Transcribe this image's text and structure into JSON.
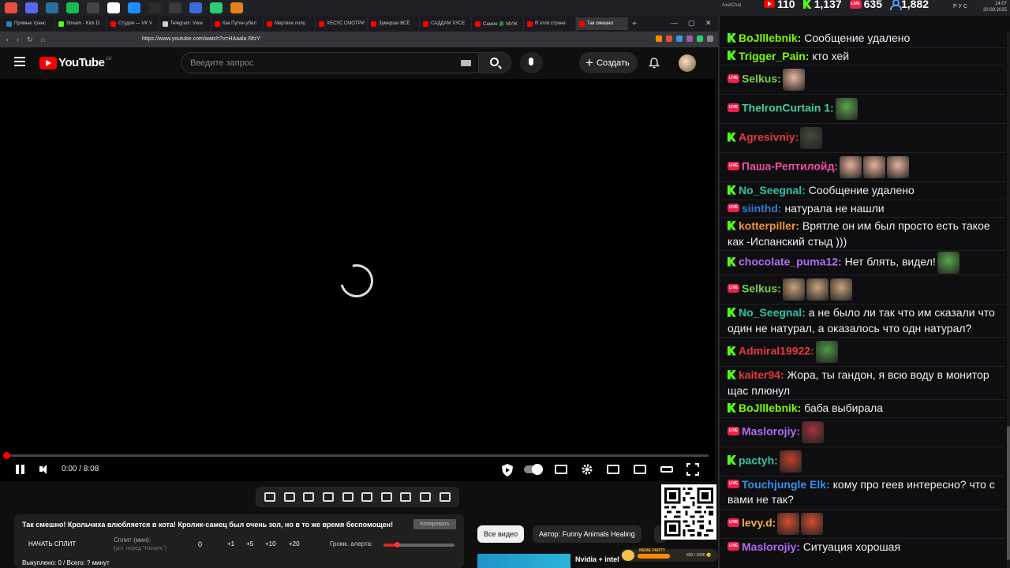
{
  "taskbar": {
    "clock_time": "14:07",
    "clock_date": "20.09.2025",
    "lang": "РУС",
    "icon_colors": [
      "#e74c3c",
      "#5865f2",
      "#2a6e9f",
      "#1db954",
      "#444",
      "#ffffff",
      "#1f8cff",
      "#2c2c2c",
      "#3a3a3a",
      "#3a6cd6",
      "#2ecc71",
      "#e67e22"
    ]
  },
  "browser": {
    "tabs": [
      {
        "label": "Прямые транс",
        "color": "#2980b9"
      },
      {
        "label": "Stream - Kick D",
        "color": "#53fc18"
      },
      {
        "label": "Студия — VK V",
        "color": "#ff0000"
      },
      {
        "label": "Telegram: View",
        "color": "#cccccc"
      },
      {
        "label": "Как Путин убил",
        "color": "#ff0000"
      },
      {
        "label": "Мертвое полу",
        "color": "#ff0000"
      },
      {
        "label": "ХЕСУС СМОТРИ",
        "color": "#ff0000"
      },
      {
        "label": "Зумерши ВСЁ",
        "color": "#ff0000"
      },
      {
        "label": "САДДАМ ХУСЕ",
        "color": "#ff0000"
      },
      {
        "label": "Самое 🐉 МУЖ",
        "color": "#ff0000"
      },
      {
        "label": "В этой стране",
        "color": "#ff0000"
      },
      {
        "label": "Так смешно",
        "color": "#ff0000",
        "active": true
      }
    ],
    "url": "https://www.youtube.com/watch?v=HAaala l9fzY"
  },
  "youtube": {
    "logo_text": "YouTube",
    "country": "LV",
    "search_placeholder": "Введите запрос",
    "create_label": "Создать",
    "time": "0:00 / 8:08",
    "progress": 0
  },
  "split": {
    "title": "Так смешно! Крольчиха влюбляется в кота! Кролик-самец был очень зол, но в то же время беспомощен!",
    "copy_label": "Копировать",
    "start_label": "НАЧАТЬ СПЛИТ",
    "minutes_label": "Сплит (мин):",
    "minutes_hint": "(уст. перед \"Начать\")",
    "minutes_value": "0",
    "adds": [
      "+1",
      "+5",
      "+10",
      "+20"
    ],
    "alert_volume_label": "Громк. алерта:",
    "alert_volume": 0.2,
    "bought_label": "Выкуплено: 0 / Всего: ? минут"
  },
  "chips": {
    "all": "Все видео",
    "author": "Автор: Funny Animals Healing"
  },
  "suggestion": {
    "title": "Nvidia + intel"
  },
  "meme": {
    "label": "MEME PARTY",
    "count": "650 / 1500 😊",
    "fill": 0.43
  },
  "chat": {
    "app_name": "AxelChat",
    "stats": {
      "youtube": "110",
      "kick": "1,137",
      "live": "635",
      "viewers": "1,882"
    },
    "messages": [
      {
        "src": "kick",
        "name": "BoJlllebnik:",
        "color": "#7cfc00",
        "text": "Сообщение удалено"
      },
      {
        "src": "kick",
        "name": "Trigger_Pain:",
        "color": "#7cfc00",
        "text": "кто хей"
      },
      {
        "src": "live",
        "name": "Selkus:",
        "color": "#7ccd4a",
        "text": "",
        "emotes": [
          "#e9b9a3"
        ]
      },
      {
        "src": "live",
        "name": "TheIronCurtain 1:",
        "color": "#3fcf9e",
        "text": "",
        "emotes": [
          "#5aa64c"
        ]
      },
      {
        "src": "kick",
        "name": "Agresivniy:",
        "color": "#e33b3b",
        "text": "",
        "emotes": [
          "#3e4a3a"
        ]
      },
      {
        "src": "live",
        "name": "Паша-Рептилойд:",
        "color": "#f04f9d",
        "text": "",
        "emotes": [
          "#e6b29b",
          "#e6b29b",
          "#e6b29b"
        ]
      },
      {
        "src": "kick",
        "name": "No_Seegnal:",
        "color": "#2ec3a4",
        "text": "Сообщение удалено"
      },
      {
        "src": "live",
        "name": "siinthd:",
        "color": "#2f7bd1",
        "text": "натурала не нашли"
      },
      {
        "src": "kick",
        "name": "kotterpiller:",
        "color": "#f29437",
        "text": "Врятле он им был просто есть такое как -Испанский стыд )))"
      },
      {
        "src": "kick",
        "name": "chocolate_puma12:",
        "color": "#b06bf5",
        "text": "Нет блять, видел!",
        "emotes": [
          "#58a94d"
        ]
      },
      {
        "src": "live",
        "name": "Selkus:",
        "color": "#7ccd4a",
        "text": "",
        "emotes": [
          "#c9a27c",
          "#c9a27c",
          "#c9a27c"
        ]
      },
      {
        "src": "kick",
        "name": "No_Seegnal:",
        "color": "#2ec3a4",
        "text": "а не было ли так что им сказали что один не натурал, а оказалось что одн натурал?"
      },
      {
        "src": "kick",
        "name": "Admiral19922:",
        "color": "#e33b3b",
        "text": "",
        "emotes": [
          "#4f9a44"
        ]
      },
      {
        "src": "kick",
        "name": "kaiter94:",
        "color": "#e33b3b",
        "text": "Жора, ты гандон, я всю воду в монитор щас плюнул"
      },
      {
        "src": "kick",
        "name": "BoJlllebnik:",
        "color": "#7cfc00",
        "text": "баба выбирала"
      },
      {
        "src": "live",
        "name": "Maslorojiy:",
        "color": "#b06bf5",
        "text": "",
        "emotes": [
          "#a3333f"
        ]
      },
      {
        "src": "kick",
        "name": "pactyh:",
        "color": "#2ec3a4",
        "text": "",
        "emotes": [
          "#c0402a"
        ]
      },
      {
        "src": "live",
        "name": "Touchjungle Elk:",
        "color": "#3b8ef0",
        "text": "кому про геев интересно? что с вами не так?"
      },
      {
        "src": "live",
        "name": "levy.d:",
        "color": "#f2b134",
        "text": "",
        "emotes": [
          "#d3502e",
          "#d3502e"
        ]
      },
      {
        "src": "live",
        "name": "Maslorojiy:",
        "color": "#b06bf5",
        "text": "Ситуация хорошая"
      }
    ]
  }
}
